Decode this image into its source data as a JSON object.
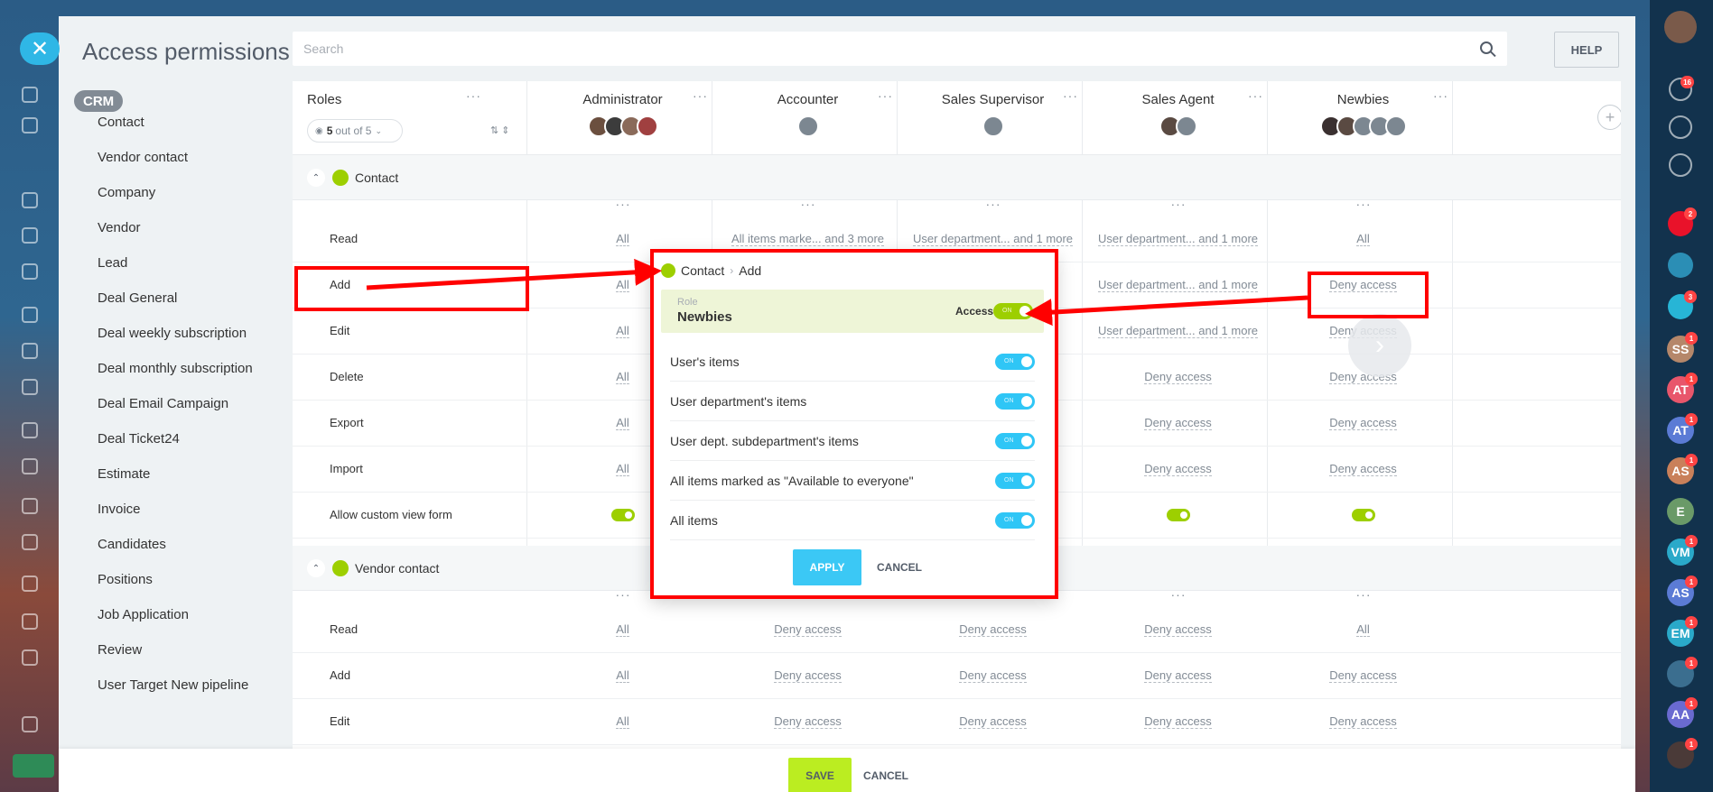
{
  "panel": {
    "title": "Access permissions",
    "search_placeholder": "Search",
    "help_label": "HELP"
  },
  "entity_menu": {
    "section": "CRM",
    "items": [
      "Contact",
      "Vendor contact",
      "Company",
      "Vendor",
      "Lead",
      "Deal General",
      "Deal weekly subscription",
      "Deal monthly subscription",
      "Deal Email Campaign",
      "Deal Ticket24",
      "Estimate",
      "Invoice",
      "Candidates",
      "Positions",
      "Job Application",
      "Review",
      "User Target New pipeline"
    ]
  },
  "roles_header": {
    "label": "Roles",
    "filter_count": "5",
    "filter_text": "out of 5",
    "roles": [
      "Administrator",
      "Accounter",
      "Sales Supervisor",
      "Sales Agent",
      "Newbies"
    ]
  },
  "sections": [
    {
      "name": "Contact",
      "rows": [
        {
          "label": "Read",
          "cells": [
            "All",
            "All items marke... and 3 more",
            "User department... and 1 more",
            "User department... and 1 more",
            "All"
          ]
        },
        {
          "label": "Add",
          "cells": [
            "All",
            "",
            "",
            "User department... and 1 more",
            "Deny access"
          ]
        },
        {
          "label": "Edit",
          "cells": [
            "All",
            "",
            "",
            "User department... and 1 more",
            "Deny access"
          ]
        },
        {
          "label": "Delete",
          "cells": [
            "All",
            "",
            "",
            "Deny access",
            "Deny access"
          ]
        },
        {
          "label": "Export",
          "cells": [
            "All",
            "",
            "",
            "Deny access",
            "Deny access"
          ]
        },
        {
          "label": "Import",
          "cells": [
            "All",
            "",
            "",
            "Deny access",
            "Deny access"
          ]
        },
        {
          "label": "Allow custom view form",
          "cells": [
            "toggle",
            "",
            "",
            "toggle",
            "toggle"
          ]
        }
      ]
    },
    {
      "name": "Vendor contact",
      "rows": [
        {
          "label": "Read",
          "cells": [
            "All",
            "Deny access",
            "Deny access",
            "Deny access",
            "All"
          ]
        },
        {
          "label": "Add",
          "cells": [
            "All",
            "Deny access",
            "Deny access",
            "Deny access",
            "Deny access"
          ]
        },
        {
          "label": "Edit",
          "cells": [
            "All",
            "Deny access",
            "Deny access",
            "Deny access",
            "Deny access"
          ]
        }
      ]
    }
  ],
  "popup": {
    "crumb_entity": "Contact",
    "crumb_action": "Add",
    "role_caption": "Role",
    "role_value": "Newbies",
    "access_label": "Access",
    "toggle_text": "ON",
    "options": [
      "User's items",
      "User department's items",
      "User dept. subdepartment's items",
      "All items marked as \"Available to everyone\"",
      "All items"
    ],
    "apply_label": "APPLY",
    "cancel_label": "CANCEL"
  },
  "footer": {
    "save_label": "SAVE",
    "cancel_label": "CANCEL"
  },
  "right_rail": {
    "notification_count": "16",
    "contacts": [
      {
        "initials": "SS",
        "color": "#b5876a",
        "badge": "1"
      },
      {
        "initials": "AT",
        "color": "#e8566b",
        "badge": "1"
      },
      {
        "initials": "AT",
        "color": "#5b7bd5",
        "badge": "1"
      },
      {
        "initials": "AS",
        "color": "#c9805a",
        "badge": "1"
      },
      {
        "initials": "E",
        "color": "#6a9a68",
        "badge": ""
      },
      {
        "initials": "VM",
        "color": "#2aa9c9",
        "badge": "1"
      },
      {
        "initials": "AS",
        "color": "#5b7bd5",
        "badge": "1"
      },
      {
        "initials": "EM",
        "color": "#2aa9c9",
        "badge": "1"
      },
      {
        "initials": "",
        "color": "#3b6e8f",
        "badge": "1"
      },
      {
        "initials": "AA",
        "color": "#6a6ad0",
        "badge": "1"
      },
      {
        "initials": "",
        "color": "#4a3a38",
        "badge": "1"
      }
    ]
  },
  "colors": {
    "accent_blue": "#2fc6f6",
    "accent_green": "#9dcf00",
    "save_green": "#bbed21",
    "annotation_red": "#ff0000"
  }
}
